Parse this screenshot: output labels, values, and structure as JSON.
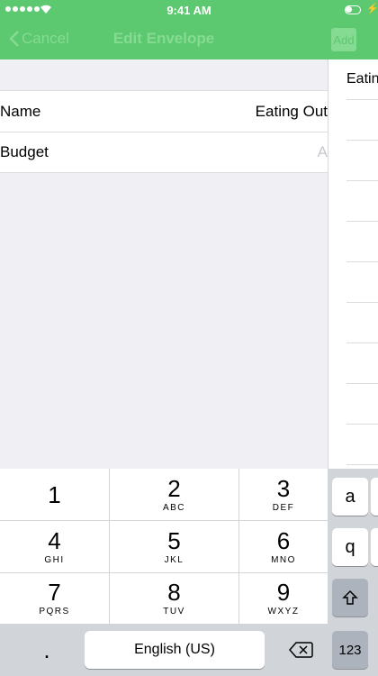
{
  "status_bar": {
    "time": "9:41 AM"
  },
  "nav": {
    "back_label": "Cancel",
    "title": "Edit Envelope",
    "right_label": "Add"
  },
  "form": {
    "rows": [
      {
        "label": "Name",
        "value": "Eating Out"
      },
      {
        "label": "Budget",
        "placeholder": "A"
      }
    ]
  },
  "side_panel": {
    "title": "Eating"
  },
  "keypad": {
    "keys": [
      {
        "num": "1",
        "letters": ""
      },
      {
        "num": "2",
        "letters": "ABC"
      },
      {
        "num": "3",
        "letters": "DEF"
      },
      {
        "num": "4",
        "letters": "GHI"
      },
      {
        "num": "5",
        "letters": "JKL"
      },
      {
        "num": "6",
        "letters": "MNO"
      },
      {
        "num": "7",
        "letters": "PQRS"
      },
      {
        "num": "8",
        "letters": "TUV"
      },
      {
        "num": "9",
        "letters": "WXYZ"
      }
    ],
    "dot": ".",
    "language": "English (US)"
  },
  "side_keyboard": {
    "keys": [
      "a",
      "q"
    ],
    "numbers_label": "123"
  },
  "colors": {
    "accent": "#5cc870"
  }
}
